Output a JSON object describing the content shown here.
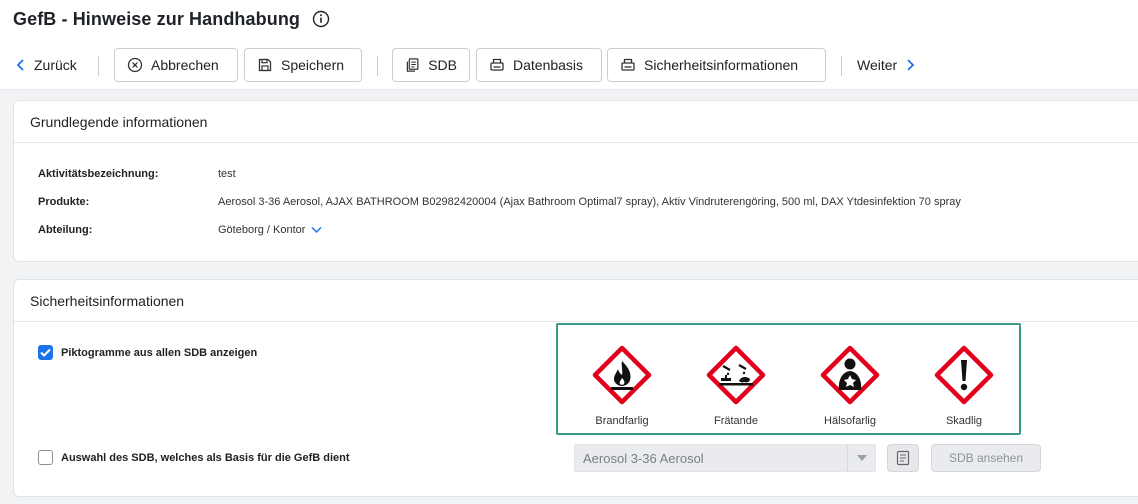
{
  "header": {
    "title": "GefB - Hinweise zur Handhabung",
    "info_icon": "info-circle-icon"
  },
  "toolbar": {
    "back_label": "Zurück",
    "cancel_label": "Abbrechen",
    "save_label": "Speichern",
    "sdb_label": "SDB",
    "database_label": "Datenbasis",
    "safety_info_label": "Sicherheitsinformationen",
    "next_label": "Weiter",
    "icons": {
      "back": "chevron-left-icon",
      "cancel": "close-circle-icon",
      "save": "floppy-disk-icon",
      "sdb": "documents-icon",
      "database": "printer-icon",
      "safety_info": "printer-icon",
      "next": "chevron-right-icon"
    }
  },
  "basic_info": {
    "title": "Grundlegende informationen",
    "rows": [
      {
        "label": "Aktivitätsbezeichnung:",
        "value": "test"
      },
      {
        "label": "Produkte:",
        "value": "Aerosol 3-36 Aerosol, AJAX BATHROOM B02982420004 (Ajax Bathroom Optimal7 spray), Aktiv Vindruterengöring, 500 ml, DAX Ytdesinfektion 70 spray"
      },
      {
        "label": "Abteilung:",
        "value": "Göteborg / Kontor"
      }
    ]
  },
  "safety_info": {
    "title": "Sicherheitsinformationen",
    "show_pictograms_label": "Piktogramme aus allen SDB anzeigen",
    "show_pictograms_checked": true,
    "select_sdb_label": "Auswahl des SDB, welches als Basis für die GefB dient",
    "select_sdb_checked": false,
    "pictograms": [
      {
        "label": "Brandfarlig",
        "icon": "flame-pictogram-icon"
      },
      {
        "label": "Frätande",
        "icon": "corrosive-pictogram-icon"
      },
      {
        "label": "Hälsofarlig",
        "icon": "health-hazard-pictogram-icon"
      },
      {
        "label": "Skadlig",
        "icon": "exclamation-pictogram-icon"
      }
    ],
    "sdb_select_value": "Aerosol 3-36 Aerosol",
    "sdb_view_button": "SDB ansehen"
  },
  "colors": {
    "accent": "#1e73e8",
    "highlight_border": "#3a9a86",
    "hazard_red": "#e3001b"
  }
}
